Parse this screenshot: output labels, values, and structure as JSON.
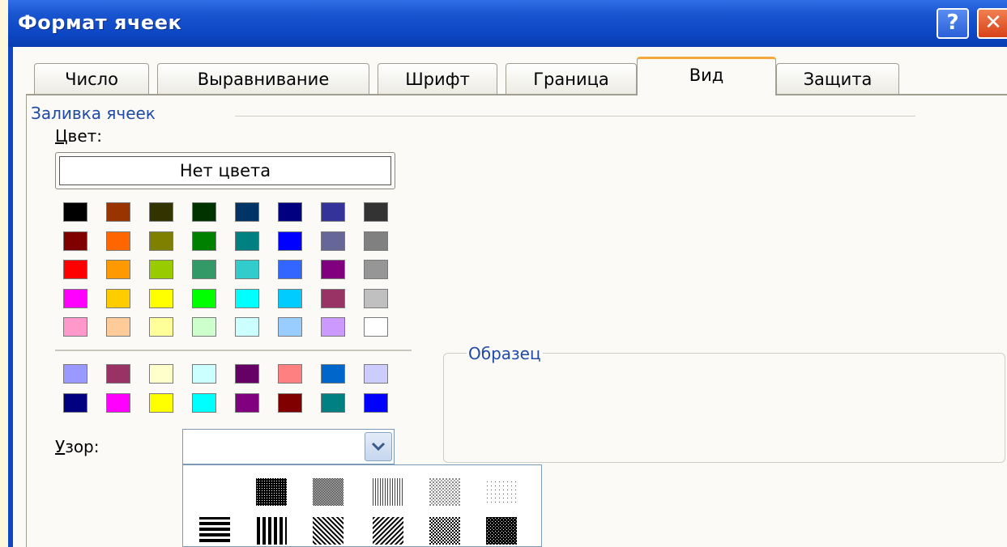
{
  "window": {
    "title": "Формат ячеек",
    "help_label": "?",
    "close_label": "✕"
  },
  "tabs": [
    {
      "label": "Число"
    },
    {
      "label": "Выравнивание"
    },
    {
      "label": "Шрифт"
    },
    {
      "label": "Граница"
    },
    {
      "label": "Вид",
      "active": true
    },
    {
      "label": "Защита"
    }
  ],
  "fill": {
    "group_label": "Заливка ячеек",
    "color_label_first": "Ц",
    "color_label_rest": "вет:",
    "no_color_label": "Нет цвета",
    "palette": [
      [
        "#000000",
        "#993300",
        "#333300",
        "#003300",
        "#003366",
        "#000080",
        "#333399",
        "#333333"
      ],
      [
        "#800000",
        "#ff6600",
        "#808000",
        "#008000",
        "#008080",
        "#0000ff",
        "#666699",
        "#808080"
      ],
      [
        "#ff0000",
        "#ff9900",
        "#99cc00",
        "#339966",
        "#33cccc",
        "#3366ff",
        "#800080",
        "#969696"
      ],
      [
        "#ff00ff",
        "#ffcc00",
        "#ffff00",
        "#00ff00",
        "#00ffff",
        "#00ccff",
        "#993366",
        "#c0c0c0"
      ],
      [
        "#ff99cc",
        "#ffcc99",
        "#ffff99",
        "#ccffcc",
        "#ccffff",
        "#99ccff",
        "#cc99ff",
        "#ffffff"
      ]
    ],
    "extra_palette": [
      [
        "#9999ff",
        "#993366",
        "#ffffcc",
        "#ccffff",
        "#660066",
        "#ff8080",
        "#0066cc",
        "#ccccff"
      ],
      [
        "#000080",
        "#ff00ff",
        "#ffff00",
        "#00ffff",
        "#800080",
        "#800000",
        "#008080",
        "#0000ff"
      ]
    ]
  },
  "pattern": {
    "label_first": "У",
    "label_rest": "зор:",
    "value": "",
    "options": [
      "solid",
      "dark-gray",
      "medium-gray",
      "light-gray",
      "gray-12",
      "gray-6",
      "horizontal-stripe",
      "vertical-stripe",
      "reverse-diagonal",
      "diagonal-stripe",
      "diagonal-crosshatch",
      "thick-crosshatch"
    ]
  },
  "sample": {
    "label": "Образец"
  }
}
